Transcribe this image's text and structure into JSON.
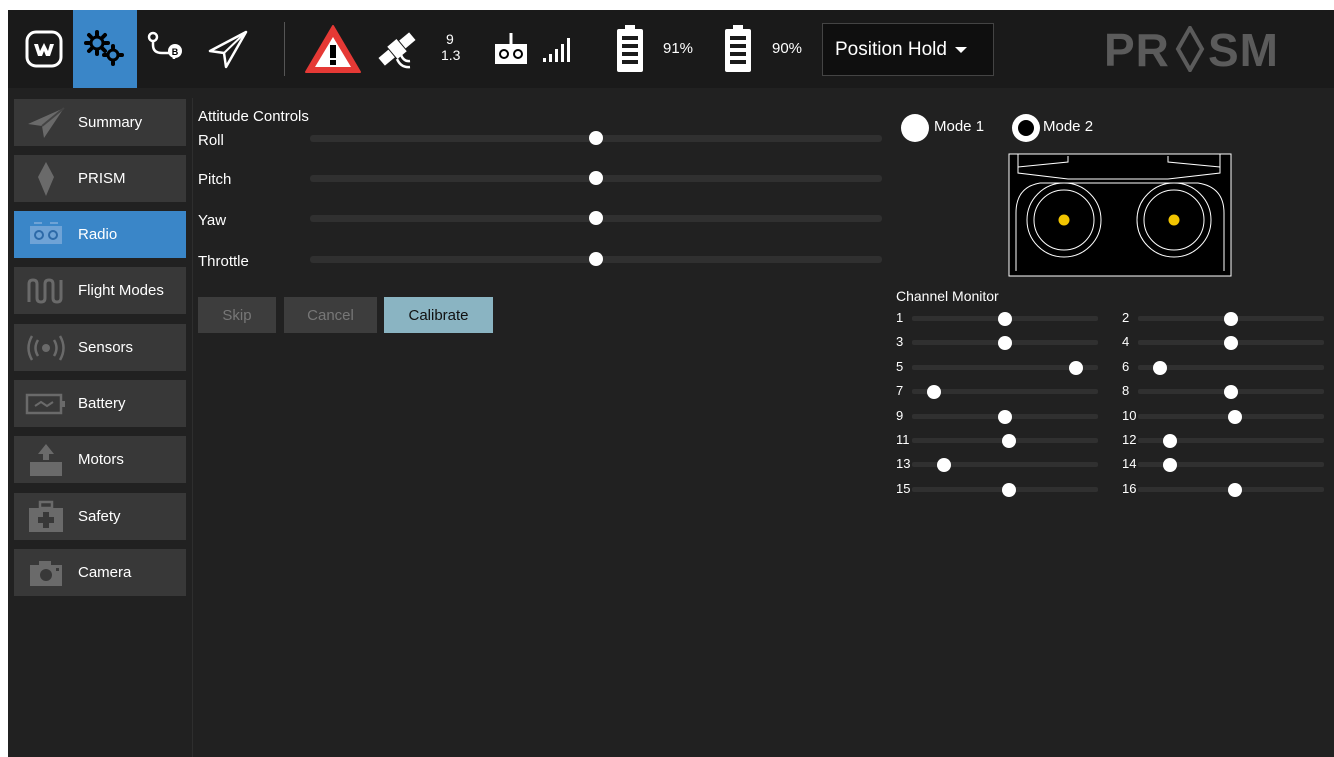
{
  "toolbar": {
    "satellite_count": "9",
    "hdop": "1.3",
    "battery1_percent": "91%",
    "battery2_percent": "90%",
    "flight_mode": "Position Hold",
    "brand": "PRISM",
    "accent_color": "#3a86c8",
    "warning_color": "#e53935"
  },
  "sidebar": {
    "items": [
      {
        "label": "Summary",
        "icon": "paper-plane-icon"
      },
      {
        "label": "PRISM",
        "icon": "prism-diamond-icon"
      },
      {
        "label": "Radio",
        "icon": "radio-transmitter-icon",
        "active": true
      },
      {
        "label": "Flight Modes",
        "icon": "waveform-icon"
      },
      {
        "label": "Sensors",
        "icon": "broadcast-icon"
      },
      {
        "label": "Battery",
        "icon": "battery-icon"
      },
      {
        "label": "Motors",
        "icon": "motor-icon"
      },
      {
        "label": "Safety",
        "icon": "first-aid-icon"
      },
      {
        "label": "Camera",
        "icon": "camera-icon"
      }
    ]
  },
  "attitude": {
    "title": "Attitude Controls",
    "controls": [
      {
        "label": "Roll",
        "position": 0.5
      },
      {
        "label": "Pitch",
        "position": 0.5
      },
      {
        "label": "Yaw",
        "position": 0.5
      },
      {
        "label": "Throttle",
        "position": 0.5
      }
    ]
  },
  "actions": {
    "skip": "Skip",
    "cancel": "Cancel",
    "calibrate": "Calibrate"
  },
  "modes": {
    "mode1": "Mode 1",
    "mode2": "Mode 2",
    "selected": "Mode 2"
  },
  "channel_monitor": {
    "title": "Channel Monitor",
    "channels": [
      {
        "label": "1",
        "value": 0.5
      },
      {
        "label": "2",
        "value": 0.5
      },
      {
        "label": "3",
        "value": 0.5
      },
      {
        "label": "4",
        "value": 0.5
      },
      {
        "label": "5",
        "value": 0.88
      },
      {
        "label": "6",
        "value": 0.12
      },
      {
        "label": "7",
        "value": 0.12
      },
      {
        "label": "8",
        "value": 0.5
      },
      {
        "label": "9",
        "value": 0.5
      },
      {
        "label": "10",
        "value": 0.52
      },
      {
        "label": "11",
        "value": 0.52
      },
      {
        "label": "12",
        "value": 0.17
      },
      {
        "label": "13",
        "value": 0.17
      },
      {
        "label": "14",
        "value": 0.17
      },
      {
        "label": "15",
        "value": 0.52
      },
      {
        "label": "16",
        "value": 0.52
      }
    ]
  }
}
